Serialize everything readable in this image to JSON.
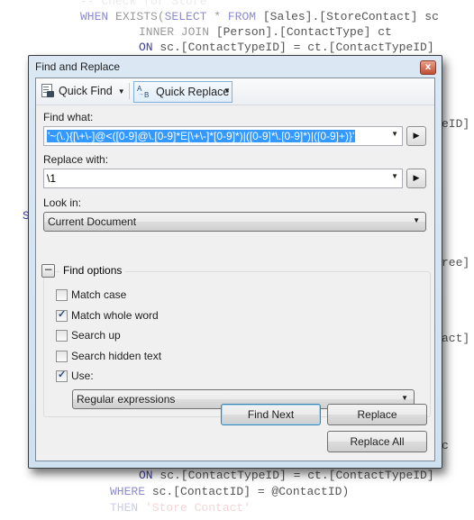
{
  "background_code": {
    "lines": [
      {
        "text": "-- Check for Store",
        "parts": [
          {
            "t": "-- Check for Store",
            "c": "faded"
          }
        ]
      },
      {
        "parts": [
          {
            "t": "WHEN ",
            "c": "kw"
          },
          {
            "t": "EXISTS(",
            "c": ""
          },
          {
            "t": "SELECT ",
            "c": "kw"
          },
          {
            "t": "* ",
            "c": ""
          },
          {
            "t": "FROM ",
            "c": "kw"
          },
          {
            "t": "[Sales].[StoreContact] sc",
            "c": "txt-dark"
          }
        ]
      },
      {
        "parts": [
          {
            "t": "INNER JOIN ",
            "c": ""
          },
          {
            "t": "[Person].[ContactType] ct",
            "c": "txt-dark"
          }
        ]
      },
      {
        "parts": [
          {
            "t": "ON ",
            "c": "kw-strong"
          },
          {
            "t": "sc.[ContactTypeID] = ct.[ContactTypeID]",
            "c": "txt-dark"
          }
        ]
      },
      {
        "parts": [
          {
            "t": "eID]",
            "c": "txt-dark"
          }
        ]
      },
      {
        "parts": [
          {
            "t": "S",
            "c": "kw-strong"
          }
        ]
      },
      {
        "parts": [
          {
            "t": "ree] =",
            "c": "txt-dark"
          }
        ]
      },
      {
        "parts": [
          {
            "t": "act]",
            "c": "txt-dark"
          }
        ]
      },
      {
        "parts": [
          {
            "t": "c",
            "c": "txt-dark"
          }
        ]
      },
      {
        "parts": [
          {
            "t": "ON ",
            "c": "kw-strong"
          },
          {
            "t": "sc.[ContactTypeID] = ct.[ContactTypeID]",
            "c": "txt-dark"
          }
        ]
      },
      {
        "parts": [
          {
            "t": "WHERE ",
            "c": "kw"
          },
          {
            "t": "sc.[ContactID] = @ContactID)",
            "c": "txt-dark"
          }
        ]
      },
      {
        "parts": [
          {
            "t": "THEN ",
            "c": "kw faded"
          },
          {
            "t": "'Store Contact'",
            "c": "str faded"
          }
        ]
      }
    ]
  },
  "dialog": {
    "title": "Find and Replace",
    "close_label": "x",
    "toolbar": {
      "quick_find": "Quick Find",
      "quick_replace": "Quick Replace",
      "caret": "▼"
    },
    "find_what": {
      "label": "Find what:",
      "value": "'~(\\.){[\\+\\-]@<([0-9]@\\.[0-9]*E[\\+\\-]*[0-9]*)|([0-9]*\\.[0-9]*)|([0-9]+)}'"
    },
    "replace_with": {
      "label": "Replace with:",
      "value": "\\1"
    },
    "look_in": {
      "label": "Look in:",
      "value": "Current Document"
    },
    "find_options": {
      "title": "Find options",
      "collapse_symbol": "−",
      "options": [
        {
          "label": "Match case",
          "checked": false
        },
        {
          "label": "Match whole word",
          "checked": true
        },
        {
          "label": "Search up",
          "checked": false
        },
        {
          "label": "Search hidden text",
          "checked": false
        },
        {
          "label": "Use:",
          "checked": true
        }
      ],
      "use_type": "Regular expressions"
    },
    "buttons": {
      "find_next": "Find Next",
      "replace": "Replace",
      "replace_all": "Replace All"
    },
    "arrow_glyph": "▶",
    "dropdown_glyph": "▼",
    "check_glyph": "✓"
  }
}
